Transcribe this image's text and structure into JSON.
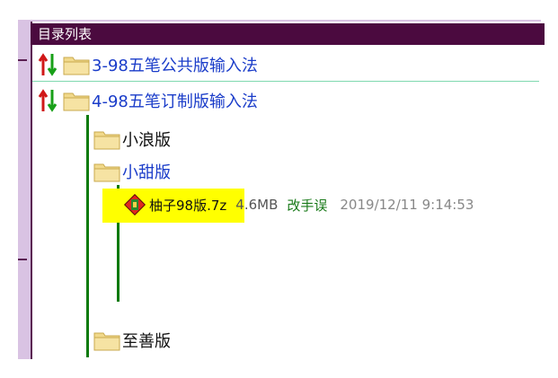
{
  "window": {
    "title": "目录列表"
  },
  "tree": {
    "top_items": [
      {
        "label": "3-98五笔公共版输入法"
      },
      {
        "label": "4-98五笔订制版输入法"
      }
    ],
    "sub_items": [
      {
        "label": "小浪版"
      },
      {
        "label": "小甜版"
      },
      {
        "label": "至善版"
      }
    ],
    "file": {
      "name": "柚子98版.7z",
      "size": "4.6MB",
      "note": "改手误",
      "date": "2019/12/11 9:14:53"
    }
  },
  "colors": {
    "titlebar": "#4b0a3f",
    "link": "#1a3cc9",
    "tree_line": "#0a7a0a",
    "highlight": "#ffff00",
    "note": "#1a7a1a"
  },
  "icons": {
    "sort": "sort-arrows-icon",
    "folder": "folder-icon",
    "archive": "archive-file-icon"
  }
}
